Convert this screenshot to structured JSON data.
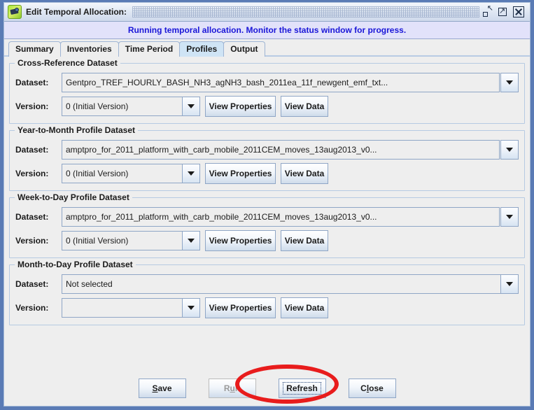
{
  "window": {
    "title": "Edit Temporal Allocation:",
    "icon": "camera-app-icon",
    "buttons": {
      "restore": "restore-window",
      "maximize": "maximize-window",
      "close": "close-window"
    }
  },
  "status": {
    "message": "Running temporal allocation. Monitor the status window for progress.",
    "text_color": "#1a16d8",
    "background_color": "#e2e2fa"
  },
  "tabs": [
    {
      "label": "Summary",
      "selected": false
    },
    {
      "label": "Inventories",
      "selected": false
    },
    {
      "label": "Time Period",
      "selected": false
    },
    {
      "label": "Profiles",
      "selected": true
    },
    {
      "label": "Output",
      "selected": false
    }
  ],
  "labels": {
    "dataset": "Dataset:",
    "version": "Version:",
    "view_properties": "View Properties",
    "view_data": "View Data"
  },
  "groups": [
    {
      "title": "Cross-Reference Dataset",
      "dataset_value": "Gentpro_TREF_HOURLY_BASH_NH3_agNH3_bash_2011ea_11f_newgent_emf_txt...",
      "version_value": "0 (Initial Version)",
      "combo_style": "split"
    },
    {
      "title": "Year-to-Month Profile Dataset",
      "dataset_value": "amptpro_for_2011_platform_with_carb_mobile_2011CEM_moves_13aug2013_v0...",
      "version_value": "0 (Initial Version)",
      "combo_style": "split"
    },
    {
      "title": "Week-to-Day Profile Dataset",
      "dataset_value": "amptpro_for_2011_platform_with_carb_mobile_2011CEM_moves_13aug2013_v0...",
      "version_value": "0 (Initial Version)",
      "combo_style": "split"
    },
    {
      "title": "Month-to-Day Profile Dataset",
      "dataset_value": "Not selected",
      "version_value": "",
      "combo_style": "unified"
    }
  ],
  "footer": {
    "save": {
      "pre": "",
      "mnemonic": "S",
      "post": "ave",
      "disabled": false,
      "focused": false
    },
    "run": {
      "pre": "R",
      "mnemonic": "u",
      "post": "n",
      "disabled": true,
      "focused": false
    },
    "refresh": {
      "pre": "Refresh",
      "mnemonic": "",
      "post": "",
      "disabled": false,
      "focused": true
    },
    "close": {
      "pre": "C",
      "mnemonic": "l",
      "post": "ose",
      "disabled": false,
      "focused": false
    }
  },
  "annotation": {
    "shape": "ellipse",
    "color": "#e81c1c",
    "targets": "refresh-button"
  }
}
